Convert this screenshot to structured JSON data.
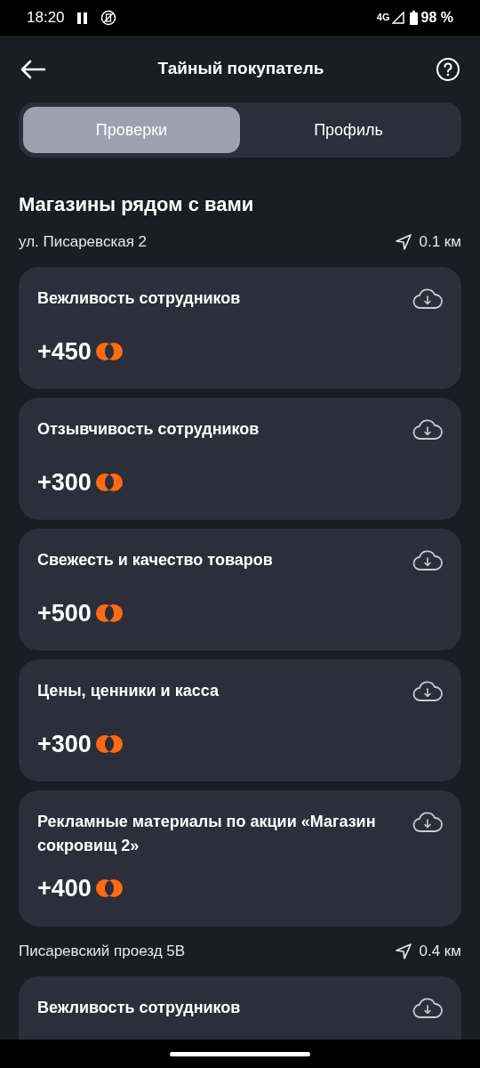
{
  "status_bar": {
    "time": "18:20",
    "network": "4G",
    "battery": "98 %"
  },
  "header": {
    "title": "Тайный покупатель"
  },
  "tabs": [
    {
      "label": "Проверки",
      "selected": true
    },
    {
      "label": "Профиль",
      "selected": false
    }
  ],
  "section_title": "Магазины рядом с вами",
  "stores": [
    {
      "address": "ул. Писаревская 2",
      "distance": "0.1 км",
      "tasks": [
        {
          "title": "Вежливость сотрудников",
          "reward": "+450"
        },
        {
          "title": "Отзывчивость сотрудников",
          "reward": "+300"
        },
        {
          "title": "Свежесть и качество товаров",
          "reward": "+500"
        },
        {
          "title": "Цены, ценники и касса",
          "reward": "+300"
        },
        {
          "title": "Рекламные материалы по акции «Магазин сокровищ 2»",
          "reward": "+400"
        }
      ]
    },
    {
      "address": "Писаревский проезд 5В",
      "distance": "0.4 км",
      "tasks": [
        {
          "title": "Вежливость сотрудников"
        }
      ]
    }
  ]
}
